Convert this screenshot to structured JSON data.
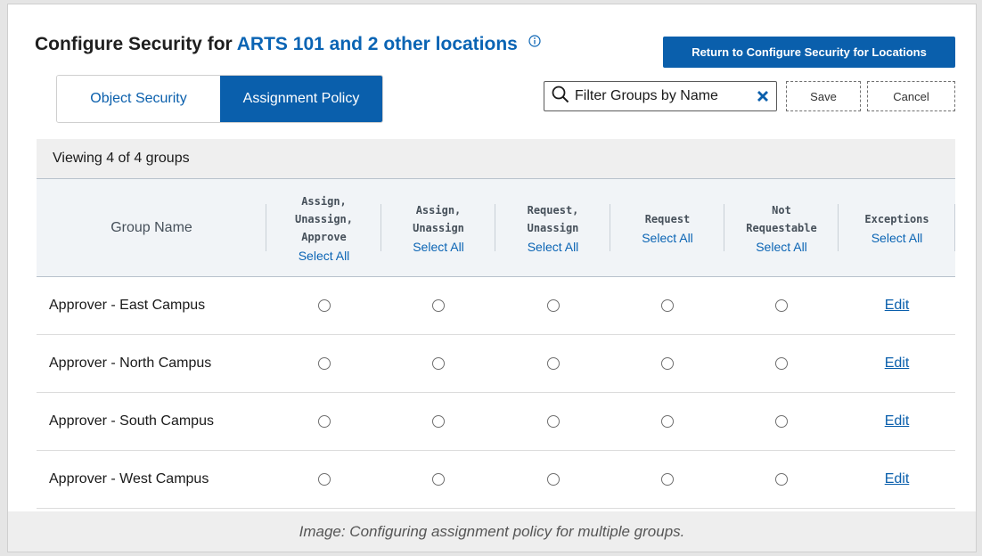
{
  "header": {
    "title_prefix": "Configure Security for",
    "title_link": "ARTS 101 and 2 other locations",
    "info_icon": "info-circle-icon",
    "return_button": "Return to Configure Security for Locations"
  },
  "tabs": [
    {
      "label": "Object Security",
      "active": false
    },
    {
      "label": "Assignment Policy",
      "active": true
    }
  ],
  "toolbar": {
    "filter_text": "Filter Groups by Name",
    "search_icon": "search-icon",
    "clear_icon": "close-x-icon",
    "save_label": "Save",
    "cancel_label": "Cancel"
  },
  "viewing_text": "Viewing 4 of 4 groups",
  "table": {
    "group_header": "Group Name",
    "columns": [
      {
        "label": "Assign,\nUnassign,\nApprove",
        "select_all": "Select All"
      },
      {
        "label": "Assign,\nUnassign",
        "select_all": "Select All"
      },
      {
        "label": "Request,\nUnassign",
        "select_all": "Select All"
      },
      {
        "label": "Request",
        "select_all": "Select All"
      },
      {
        "label": "Not\nRequestable",
        "select_all": "Select All"
      },
      {
        "label": "Exceptions",
        "select_all": "Select All"
      }
    ],
    "rows": [
      {
        "name": "Approver - East Campus",
        "exceptions": "Edit"
      },
      {
        "name": "Approver - North Campus",
        "exceptions": "Edit"
      },
      {
        "name": "Approver - South Campus",
        "exceptions": "Edit"
      },
      {
        "name": "Approver - West Campus",
        "exceptions": "Edit"
      }
    ]
  },
  "caption": "Image: Configuring assignment policy for multiple groups.",
  "colors": {
    "primary": "#0a5fac",
    "link": "#0a64b4",
    "header_bg": "#f1f4f7",
    "bar_bg": "#efefef"
  }
}
